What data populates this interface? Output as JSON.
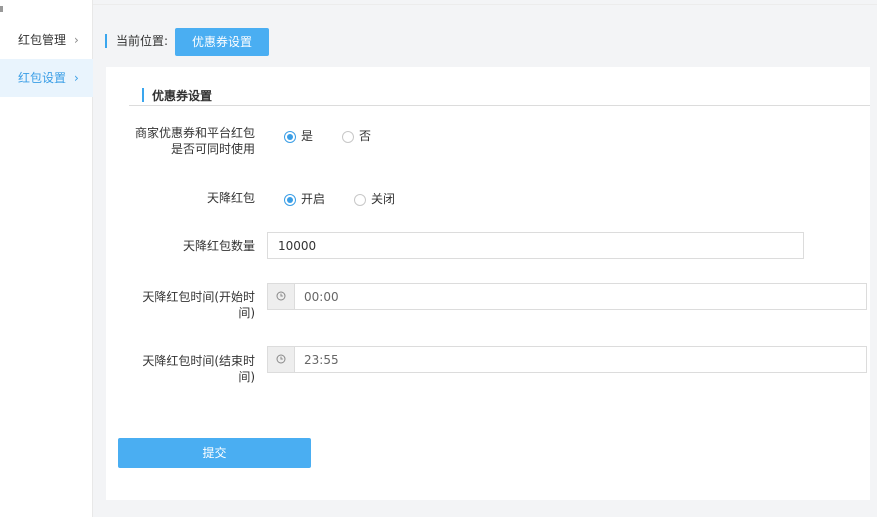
{
  "sidebar": {
    "items": [
      {
        "label": "红包管理",
        "chevron": "›",
        "active": false
      },
      {
        "label": "红包设置",
        "chevron": "›",
        "active": true
      }
    ]
  },
  "breadcrumb": {
    "label": "当前位置:",
    "current": "优惠券设置"
  },
  "section": {
    "title": "优惠券设置"
  },
  "form": {
    "coexist": {
      "label_line1": "商家优惠券和平台红包",
      "label_line2": "是否可同时使用",
      "options": [
        {
          "label": "是",
          "checked": true
        },
        {
          "label": "否",
          "checked": false
        }
      ]
    },
    "rain": {
      "label": "天降红包",
      "options": [
        {
          "label": "开启",
          "checked": true
        },
        {
          "label": "关闭",
          "checked": false
        }
      ]
    },
    "count": {
      "label": "天降红包数量",
      "value": "10000"
    },
    "start_time": {
      "label_line1": "天降红包时间(开始时",
      "label_line2": "间)",
      "value": "00:00",
      "icon": "clock-icon"
    },
    "end_time": {
      "label_line1": "天降红包时间(结束时",
      "label_line2": "间)",
      "value": "23:55",
      "icon": "clock-icon"
    }
  },
  "submit_label": "提交",
  "colors": {
    "accent": "#4aaef2",
    "active_bg": "#e9f4fd",
    "active_text": "#3a9ee6"
  }
}
